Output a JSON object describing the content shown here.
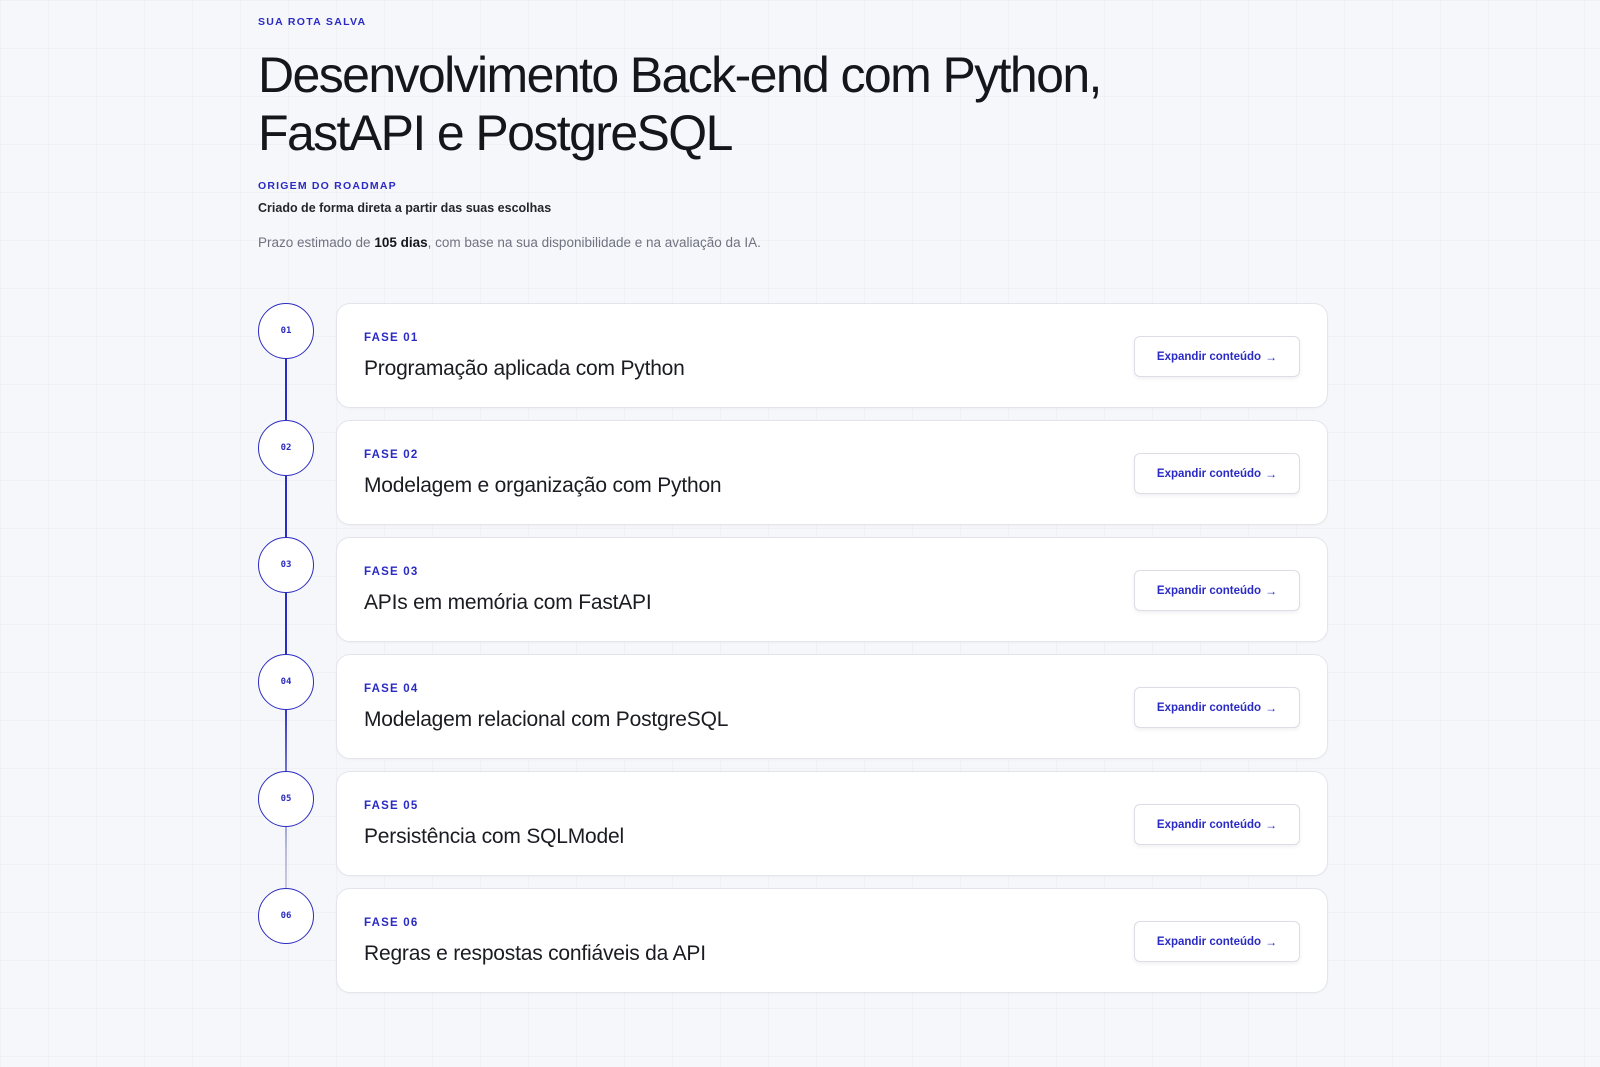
{
  "header": {
    "eyebrow": "SUA ROTA SALVA",
    "title": "Desenvolvimento Back-end com Python, FastAPI e PostgreSQL",
    "origin_label": "ORIGEM DO ROADMAP",
    "origin_desc": "Criado de forma direta a partir das suas escolhas",
    "deadline_prefix": "Prazo estimado de ",
    "deadline_value": "105 dias",
    "deadline_suffix": ", com base na sua disponibilidade e na avaliação da IA."
  },
  "button_label": "Expandir conteúdo",
  "arrow_icon": "arrow-right-icon",
  "colors": {
    "accent": "#2a2ac4",
    "background": "#f6f7fa",
    "card": "#ffffff"
  },
  "phases": [
    {
      "number": "01",
      "label": "FASE 01",
      "title": "Programação aplicada com Python",
      "button": "Expandir conteúdo"
    },
    {
      "number": "02",
      "label": "FASE 02",
      "title": "Modelagem e organização com Python",
      "button": "Expandir conteúdo"
    },
    {
      "number": "03",
      "label": "FASE 03",
      "title": "APIs em memória com FastAPI",
      "button": "Expandir conteúdo"
    },
    {
      "number": "04",
      "label": "FASE 04",
      "title": "Modelagem relacional com PostgreSQL",
      "button": "Expandir conteúdo"
    },
    {
      "number": "05",
      "label": "FASE 05",
      "title": "Persistência com SQLModel",
      "button": "Expandir conteúdo"
    },
    {
      "number": "06",
      "label": "FASE 06",
      "title": "Regras e respostas confiáveis da API",
      "button": "Expandir conteúdo"
    }
  ]
}
